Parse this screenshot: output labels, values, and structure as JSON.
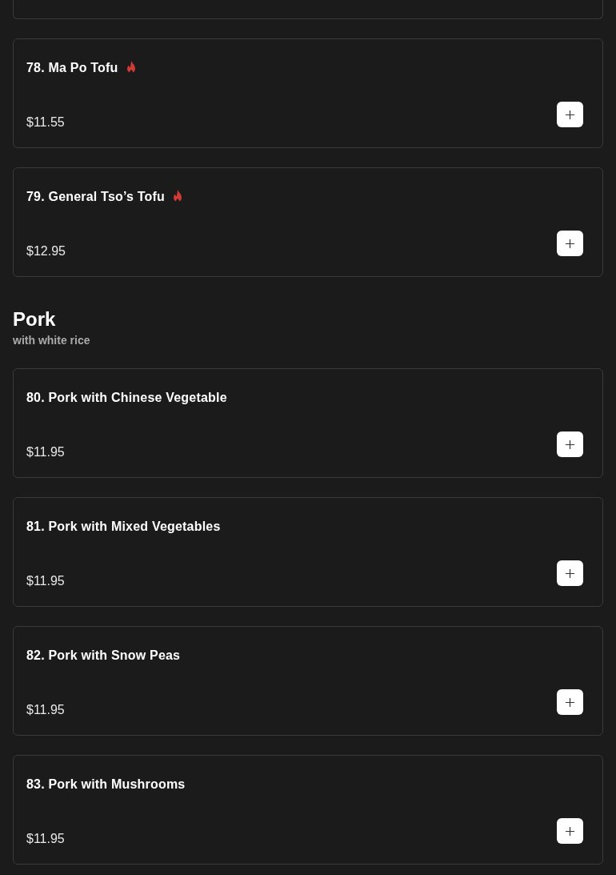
{
  "items": [
    {
      "name": "78. Ma Po Tofu",
      "spicy": true,
      "price": "$11.55"
    },
    {
      "name": "79. General Tso’s Tofu",
      "spicy": true,
      "price": "$12.95"
    }
  ],
  "sections": [
    {
      "title": "Pork",
      "subtitle": "with white rice",
      "items": [
        {
          "name": "80. Pork with Chinese Vegetable",
          "spicy": false,
          "price": "$11.95"
        },
        {
          "name": "81. Pork with Mixed Vegetables",
          "spicy": false,
          "price": "$11.95"
        },
        {
          "name": "82. Pork with Snow Peas",
          "spicy": false,
          "price": "$11.95"
        },
        {
          "name": "83. Pork with Mushrooms",
          "spicy": false,
          "price": "$11.95"
        }
      ]
    }
  ]
}
